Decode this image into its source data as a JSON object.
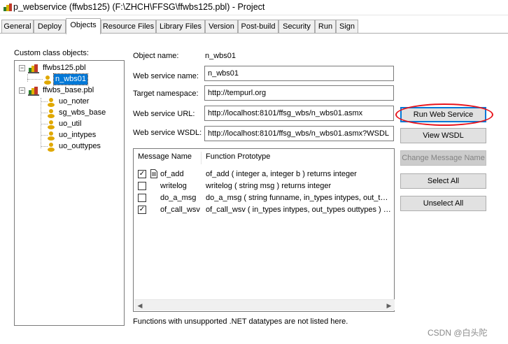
{
  "window": {
    "title": "p_webservice (ffwbs125) (F:\\ZHCH\\FFSG\\ffwbs125.pbl) - Project"
  },
  "tabs": [
    {
      "label": "General"
    },
    {
      "label": "Deploy"
    },
    {
      "label": "Objects"
    },
    {
      "label": "Resource Files"
    },
    {
      "label": "Library Files"
    },
    {
      "label": "Version"
    },
    {
      "label": "Post-build"
    },
    {
      "label": "Security"
    },
    {
      "label": "Run"
    },
    {
      "label": "Sign"
    }
  ],
  "active_tab": "Objects",
  "tree": {
    "label": "Custom class objects:",
    "libraries": [
      {
        "name": "ffwbs125.pbl",
        "objects": [
          "n_wbs01"
        ]
      },
      {
        "name": "ffwbs_base.pbl",
        "objects": [
          "uo_noter",
          "sg_wbs_base",
          "uo_util",
          "uo_intypes",
          "uo_outtypes"
        ]
      }
    ],
    "selected": "n_wbs01"
  },
  "form": {
    "object_name_label": "Object name:",
    "object_name_value": "n_wbs01",
    "web_service_name_label": "Web service name:",
    "web_service_name_value": "n_wbs01",
    "target_namespace_label": "Target namespace:",
    "target_namespace_value": "http://tempurl.org",
    "web_service_url_label": "Web service URL:",
    "web_service_url_value": "http://localhost:8101/ffsg_wbs/n_wbs01.asmx",
    "web_service_wsdl_label": "Web service WSDL:",
    "web_service_wsdl_value": "http://localhost:8101/ffsg_wbs/n_wbs01.asmx?WSDL"
  },
  "messages": {
    "columns": [
      "Message Name",
      "Function Prototype"
    ],
    "rows": [
      {
        "checked": true,
        "doc": true,
        "name": "of_add",
        "prototype": "of_add ( integer a, integer b )  returns integer"
      },
      {
        "checked": false,
        "doc": false,
        "name": "writelog",
        "prototype": "writelog ( string msg )  returns integer"
      },
      {
        "checked": false,
        "doc": false,
        "name": "do_a_msg",
        "prototype": "do_a_msg ( string funname, in_types intypes, out_types outtypes ) returns integer"
      },
      {
        "checked": true,
        "doc": false,
        "name": "of_call_wsv",
        "prototype": "of_call_wsv ( in_types intypes, out_types outtypes ) returns integer"
      }
    ],
    "footnote": "Functions with unsupported .NET datatypes are not listed here."
  },
  "buttons": {
    "run_web_service": "Run Web Service",
    "view_wsdl": "View WSDL",
    "change_message_name": "Change Message Name",
    "select_all": "Select All",
    "unselect_all": "Unselect All"
  },
  "watermark": "CSDN @白头陀",
  "colors": {
    "selection": "#0078d7",
    "annotation_circle": "#e8141c",
    "button_face": "#e1e1e1"
  }
}
